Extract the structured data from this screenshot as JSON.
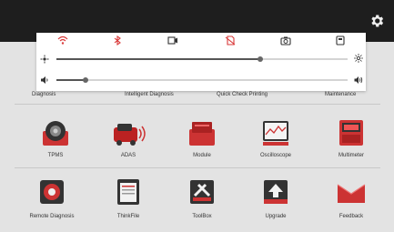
{
  "quick_panel": {
    "toggles": [
      "wifi-icon",
      "bluetooth-icon",
      "screen-record-icon",
      "no-sim-icon",
      "camera-icon",
      "screenshot-icon"
    ],
    "brightness": {
      "level": 0.7
    },
    "volume": {
      "level": 0.1
    }
  },
  "row1": {
    "labels": [
      "Diagnosis",
      "Intelligent Diagnosis",
      "Quick Check Printing",
      "Maintenance"
    ]
  },
  "apps_row2": [
    {
      "label": "TPMS",
      "icon": "tpms-icon"
    },
    {
      "label": "ADAS",
      "icon": "adas-icon"
    },
    {
      "label": "Module",
      "icon": "module-icon"
    },
    {
      "label": "Oscilloscope",
      "icon": "oscilloscope-icon"
    },
    {
      "label": "Multimeter",
      "icon": "multimeter-icon"
    }
  ],
  "apps_row3": [
    {
      "label": "Remote Diagnosis",
      "icon": "remote-diagnosis-icon"
    },
    {
      "label": "ThinkFile",
      "icon": "thinkfile-icon"
    },
    {
      "label": "ToolBox",
      "icon": "toolbox-icon"
    },
    {
      "label": "Upgrade",
      "icon": "upgrade-icon"
    },
    {
      "label": "Feedback",
      "icon": "feedback-icon"
    }
  ],
  "colors": {
    "accent": "#d93a3a",
    "topbar": "#1e1e1e"
  }
}
